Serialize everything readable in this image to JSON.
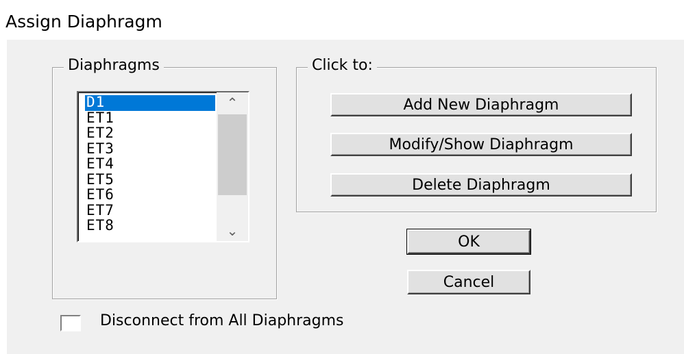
{
  "window": {
    "title": "Assign Diaphragm"
  },
  "diaphragms_group": {
    "legend": "Diaphragms",
    "items": [
      "D1",
      "ET1",
      "ET2",
      "ET3",
      "ET4",
      "ET5",
      "ET6",
      "ET7",
      "ET8"
    ],
    "selected": "D1",
    "scroll_up_icon": "chevron-up-icon",
    "scroll_down_icon": "chevron-down-icon"
  },
  "click_group": {
    "legend": "Click to:",
    "add_label": "Add New Diaphragm",
    "modify_label": "Modify/Show Diaphragm",
    "delete_label": "Delete Diaphragm"
  },
  "buttons": {
    "ok_label": "OK",
    "cancel_label": "Cancel"
  },
  "disconnect": {
    "label": "Disconnect from All Diaphragms",
    "checked": false
  },
  "colors": {
    "selection": "#0078d7",
    "dialog_bg": "#f0f0f0"
  }
}
